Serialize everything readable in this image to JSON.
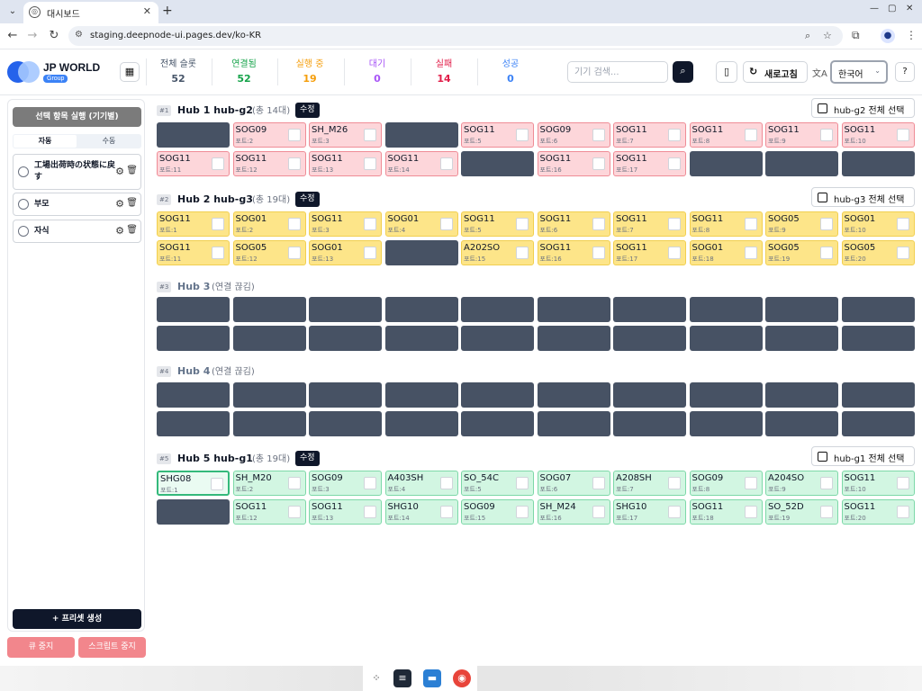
{
  "browser": {
    "tab_title": "대시보드",
    "url": "staging.deepnode-ui.pages.dev/ko-KR"
  },
  "brand": {
    "name": "JP WORLD",
    "badge": "Group"
  },
  "stats": [
    {
      "label": "전체 슬롯",
      "value": "52",
      "color": "#475569"
    },
    {
      "label": "연결됨",
      "value": "52",
      "color": "#16a34a"
    },
    {
      "label": "실행 중",
      "value": "19",
      "color": "#f59e0b"
    },
    {
      "label": "대기",
      "value": "0",
      "color": "#a855f7"
    },
    {
      "label": "실패",
      "value": "14",
      "color": "#e11d48"
    },
    {
      "label": "성공",
      "value": "0",
      "color": "#3b82f6"
    }
  ],
  "search": {
    "placeholder": "기기 검색..."
  },
  "header": {
    "refresh_label": "새로고침",
    "language": "한국어"
  },
  "sidebar": {
    "run_label": "선택 항목 실행 (기기별)",
    "tabs": [
      "자동",
      "수동"
    ],
    "presets": [
      "工場出荷時の状態に戻す",
      "부모",
      "자식"
    ],
    "create_label": "+ 프리셋 생성",
    "queue_stop": "큐 중지",
    "script_stop": "스크립트 중지"
  },
  "hubs": [
    {
      "num": "#1",
      "title": "Hub 1 hub-g2",
      "sub": "(총 14대)",
      "edit": "수정",
      "select_all": "hub-g2 전체 선택",
      "color": "red",
      "slots": [
        null,
        {
          "name": "SOG09",
          "port": "포트:2"
        },
        {
          "name": "SH_M26",
          "port": "포트:3"
        },
        null,
        {
          "name": "SOG11",
          "port": "포트:5"
        },
        {
          "name": "SOG09",
          "port": "포트:6"
        },
        {
          "name": "SOG11",
          "port": "포트:7"
        },
        {
          "name": "SOG11",
          "port": "포트:8"
        },
        {
          "name": "SOG11",
          "port": "포트:9"
        },
        {
          "name": "SOG11",
          "port": "포트:10"
        },
        {
          "name": "SOG11",
          "port": "포트:11"
        },
        {
          "name": "SOG11",
          "port": "포트:12"
        },
        {
          "name": "SOG11",
          "port": "포트:13"
        },
        {
          "name": "SOG11",
          "port": "포트:14"
        },
        null,
        {
          "name": "SOG11",
          "port": "포트:16"
        },
        {
          "name": "SOG11",
          "port": "포트:17"
        },
        null,
        null,
        null
      ]
    },
    {
      "num": "#2",
      "title": "Hub 2 hub-g3",
      "sub": "(총 19대)",
      "edit": "수정",
      "select_all": "hub-g3 전체 선택",
      "color": "yellow",
      "slots": [
        {
          "name": "SOG11",
          "port": "포트:1"
        },
        {
          "name": "SOG01",
          "port": "포트:2"
        },
        {
          "name": "SOG11",
          "port": "포트:3"
        },
        {
          "name": "SOG01",
          "port": "포트:4"
        },
        {
          "name": "SOG11",
          "port": "포트:5"
        },
        {
          "name": "SOG11",
          "port": "포트:6"
        },
        {
          "name": "SOG11",
          "port": "포트:7"
        },
        {
          "name": "SOG11",
          "port": "포트:8"
        },
        {
          "name": "SOG05",
          "port": "포트:9"
        },
        {
          "name": "SOG01",
          "port": "포트:10"
        },
        {
          "name": "SOG11",
          "port": "포트:11"
        },
        {
          "name": "SOG05",
          "port": "포트:12"
        },
        {
          "name": "SOG01",
          "port": "포트:13"
        },
        null,
        {
          "name": "A202SO",
          "port": "포트:15"
        },
        {
          "name": "SOG11",
          "port": "포트:16"
        },
        {
          "name": "SOG11",
          "port": "포트:17"
        },
        {
          "name": "SOG01",
          "port": "포트:18"
        },
        {
          "name": "SOG05",
          "port": "포트:19"
        },
        {
          "name": "SOG05",
          "port": "포트:20"
        }
      ]
    },
    {
      "num": "#3",
      "title": "Hub 3",
      "sub": "(연결 끊김)",
      "disconnected": true,
      "slots": [
        null,
        null,
        null,
        null,
        null,
        null,
        null,
        null,
        null,
        null,
        null,
        null,
        null,
        null,
        null,
        null,
        null,
        null,
        null,
        null
      ]
    },
    {
      "num": "#4",
      "title": "Hub 4",
      "sub": "(연결 끊김)",
      "disconnected": true,
      "slots": [
        null,
        null,
        null,
        null,
        null,
        null,
        null,
        null,
        null,
        null,
        null,
        null,
        null,
        null,
        null,
        null,
        null,
        null,
        null,
        null
      ]
    },
    {
      "num": "#5",
      "title": "Hub 5 hub-g1",
      "sub": "(총 19대)",
      "edit": "수정",
      "select_all": "hub-g1 전체 선택",
      "color": "green",
      "slots": [
        {
          "name": "SHG08",
          "port": "포트:1",
          "selected": true
        },
        {
          "name": "SH_M20",
          "port": "포트:2"
        },
        {
          "name": "SOG09",
          "port": "포트:3"
        },
        {
          "name": "A403SH",
          "port": "포트:4"
        },
        {
          "name": "SO_54C",
          "port": "포트:5"
        },
        {
          "name": "SOG07",
          "port": "포트:6"
        },
        {
          "name": "A208SH",
          "port": "포트:7"
        },
        {
          "name": "SOG09",
          "port": "포트:8"
        },
        {
          "name": "A204SO",
          "port": "포트:9"
        },
        {
          "name": "SOG11",
          "port": "포트:10"
        },
        null,
        {
          "name": "SOG11",
          "port": "포트:12"
        },
        {
          "name": "SOG11",
          "port": "포트:13"
        },
        {
          "name": "SHG10",
          "port": "포트:14"
        },
        {
          "name": "SOG09",
          "port": "포트:15"
        },
        {
          "name": "SH_M24",
          "port": "포트:16"
        },
        {
          "name": "SHG10",
          "port": "포트:17"
        },
        {
          "name": "SOG11",
          "port": "포트:18"
        },
        {
          "name": "SO_52D",
          "port": "포트:19"
        },
        {
          "name": "SOG11",
          "port": "포트:20"
        }
      ]
    }
  ]
}
